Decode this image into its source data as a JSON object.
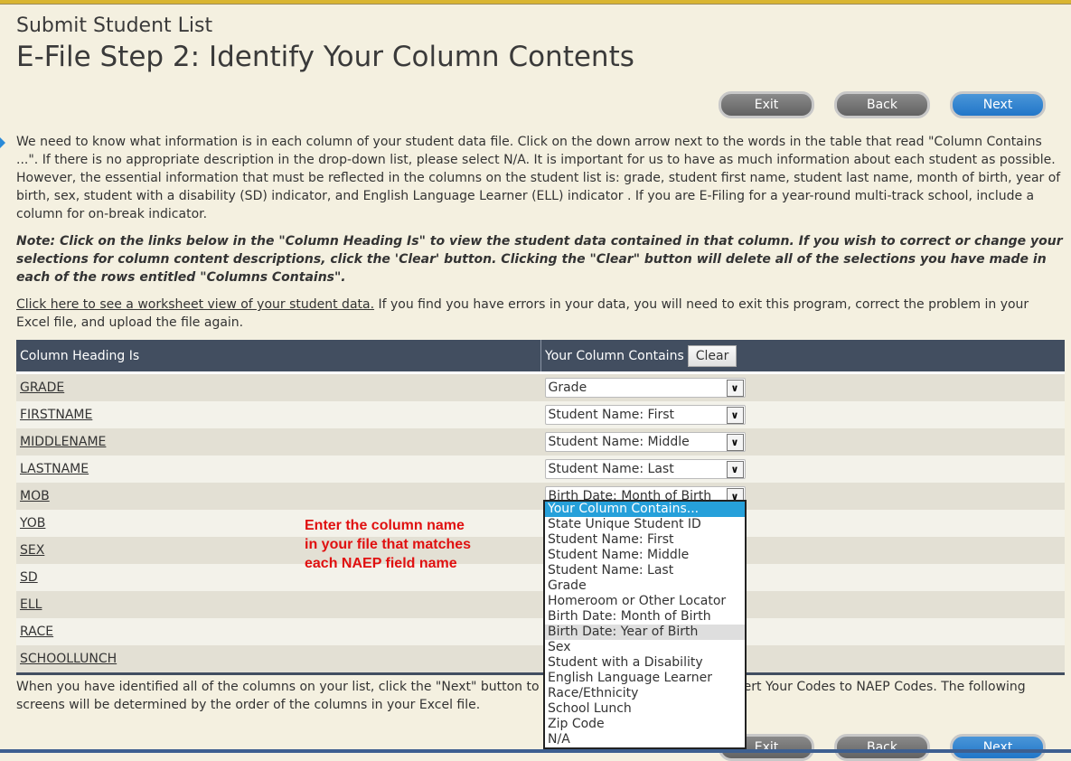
{
  "header": {
    "subtitle": "Submit Student List",
    "title": "E-File Step 2: Identify Your Column Contents"
  },
  "nav": {
    "exit": "Exit",
    "back": "Back",
    "next": "Next"
  },
  "intro": "We need to know what information is in each column of your student data file. Click on the down arrow next to the words in the table that read \"Column Contains ...\". If there is no appropriate description in the drop-down list, please select N/A. It is important for us to have as much information about each student as possible. However, the essential information that must be reflected in the columns on the student list is: grade, student first name, student last name, month of birth, year of birth, sex, student with a disability (SD) indicator, and English Language Learner (ELL) indicator . If you are E-Filing for a year-round multi-track school, include a column for on-break indicator.",
  "note": "Note: Click on the links below in the \"Column Heading Is\" to view the student data contained in that column. If you wish to correct or change your selections for column content descriptions, click the 'Clear' button. Clicking the \"Clear\" button will delete all of the selections you have made in each of the rows entitled \"Columns Contains\".",
  "worksheet": {
    "link": "Click here to see a worksheet view of your student data.",
    "text": " If you find you have errors in your data, you will need to exit this program, correct the problem in your Excel file, and upload the file again."
  },
  "table": {
    "col1": "Column Heading Is",
    "col2": "Your Column Contains",
    "clear": "Clear",
    "rows": [
      {
        "heading": "GRADE",
        "value": "Grade"
      },
      {
        "heading": "FIRSTNAME",
        "value": "Student Name: First"
      },
      {
        "heading": "MIDDLENAME",
        "value": "Student Name: Middle"
      },
      {
        "heading": "LASTNAME",
        "value": "Student Name: Last"
      },
      {
        "heading": "MOB",
        "value": "Birth Date: Month of Birth"
      },
      {
        "heading": "YOB",
        "value": ""
      },
      {
        "heading": "SEX",
        "value": ""
      },
      {
        "heading": "SD",
        "value": ""
      },
      {
        "heading": "ELL",
        "value": ""
      },
      {
        "heading": "RACE",
        "value": ""
      },
      {
        "heading": "SCHOOLLUNCH",
        "value": ""
      }
    ]
  },
  "hint": [
    "Enter the column name",
    "in your file that matches",
    "each NAEP field name"
  ],
  "bottom": "When you have identified all of the columns on your list, click the \"Next\" button to continue to the next step: Convert Your Codes to NAEP Codes. The following screens will be determined by the order of the columns in your Excel file.",
  "dropdown": {
    "highlighted": "Your Column Contains...",
    "hovered": "Birth Date: Year of Birth",
    "options": [
      "Your Column Contains...",
      "State Unique Student ID",
      "Student Name: First",
      "Student Name: Middle",
      "Student Name: Last",
      "Grade",
      "Homeroom or Other Locator",
      "Birth Date: Month of Birth",
      "Birth Date: Year of Birth",
      "Sex",
      "Student with a Disability",
      "English Language Learner",
      "Race/Ethnicity",
      "School Lunch",
      "Zip Code",
      "N/A"
    ]
  },
  "colors": {
    "accent": "#2176c8",
    "header_bg": "#424e60",
    "hint": "#e01010",
    "highlight": "#26a0da"
  }
}
